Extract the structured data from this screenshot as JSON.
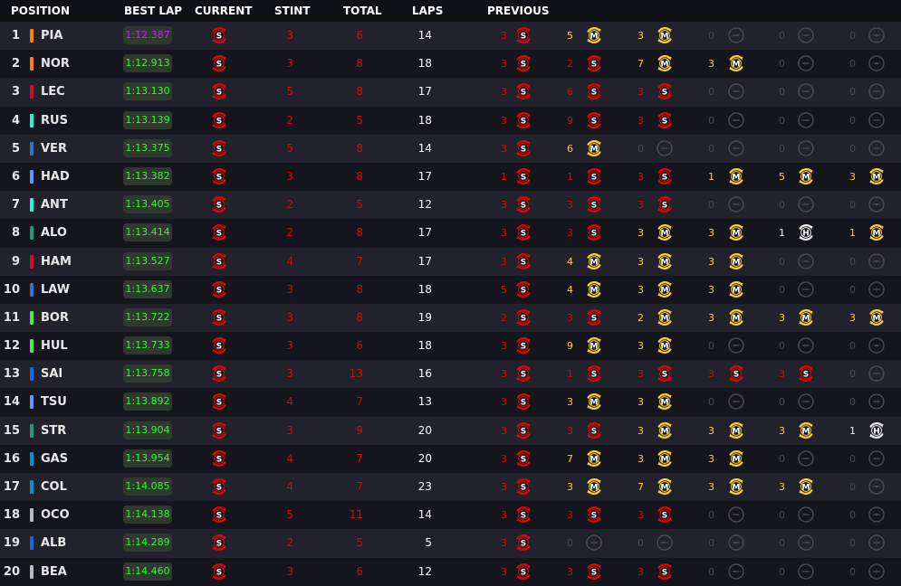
{
  "header": {
    "position": "POSITION",
    "best_lap": "BEST LAP",
    "current": "CURRENT",
    "stint": "STINT",
    "total": "TOTAL",
    "laps": "LAPS",
    "previous": "PREVIOUS"
  },
  "colors": {
    "soft": "#e10600",
    "medium": "#ffd12e",
    "hard": "#f0f0f0",
    "empty": "#4a4a55",
    "purple_lap": "#cc22ff",
    "green_lap": "#3ef03e"
  },
  "rows": [
    {
      "pos": "1",
      "driver": "PIA",
      "team_color": "#ff8000",
      "best_lap": "1:12.387",
      "best_lap_kind": "purple",
      "current": "S",
      "stint": "3",
      "total": "6",
      "laps": "14",
      "previous": [
        {
          "n": "3",
          "c": "S"
        },
        {
          "n": "5",
          "c": "M"
        },
        {
          "n": "3",
          "c": "M"
        },
        {
          "n": "0",
          "c": "E"
        },
        {
          "n": "0",
          "c": "E"
        },
        {
          "n": "0",
          "c": "E"
        }
      ]
    },
    {
      "pos": "2",
      "driver": "NOR",
      "team_color": "#ff8000",
      "best_lap": "1:12.913",
      "best_lap_kind": "green",
      "current": "S",
      "stint": "3",
      "total": "8",
      "laps": "18",
      "previous": [
        {
          "n": "3",
          "c": "S"
        },
        {
          "n": "2",
          "c": "S"
        },
        {
          "n": "7",
          "c": "M"
        },
        {
          "n": "3",
          "c": "M"
        },
        {
          "n": "0",
          "c": "E"
        },
        {
          "n": "0",
          "c": "E"
        }
      ]
    },
    {
      "pos": "3",
      "driver": "LEC",
      "team_color": "#c8102e",
      "best_lap": "1:13.130",
      "best_lap_kind": "green",
      "current": "S",
      "stint": "5",
      "total": "8",
      "laps": "17",
      "previous": [
        {
          "n": "3",
          "c": "S"
        },
        {
          "n": "6",
          "c": "S"
        },
        {
          "n": "3",
          "c": "S"
        },
        {
          "n": "0",
          "c": "E"
        },
        {
          "n": "0",
          "c": "E"
        },
        {
          "n": "0",
          "c": "E"
        }
      ]
    },
    {
      "pos": "4",
      "driver": "RUS",
      "team_color": "#27f4d2",
      "best_lap": "1:13.139",
      "best_lap_kind": "green",
      "current": "S",
      "stint": "2",
      "total": "5",
      "laps": "18",
      "previous": [
        {
          "n": "3",
          "c": "S"
        },
        {
          "n": "9",
          "c": "S"
        },
        {
          "n": "3",
          "c": "S"
        },
        {
          "n": "0",
          "c": "E"
        },
        {
          "n": "0",
          "c": "E"
        },
        {
          "n": "0",
          "c": "E"
        }
      ]
    },
    {
      "pos": "5",
      "driver": "VER",
      "team_color": "#3671c6",
      "best_lap": "1:13.375",
      "best_lap_kind": "green",
      "current": "S",
      "stint": "5",
      "total": "8",
      "laps": "14",
      "previous": [
        {
          "n": "3",
          "c": "S"
        },
        {
          "n": "6",
          "c": "M"
        },
        {
          "n": "0",
          "c": "E"
        },
        {
          "n": "0",
          "c": "E"
        },
        {
          "n": "0",
          "c": "E"
        },
        {
          "n": "0",
          "c": "E"
        }
      ]
    },
    {
      "pos": "6",
      "driver": "HAD",
      "team_color": "#6692ff",
      "best_lap": "1:13.382",
      "best_lap_kind": "green",
      "current": "S",
      "stint": "3",
      "total": "8",
      "laps": "17",
      "previous": [
        {
          "n": "1",
          "c": "S"
        },
        {
          "n": "1",
          "c": "S"
        },
        {
          "n": "3",
          "c": "S"
        },
        {
          "n": "1",
          "c": "M"
        },
        {
          "n": "5",
          "c": "M"
        },
        {
          "n": "3",
          "c": "M"
        }
      ]
    },
    {
      "pos": "7",
      "driver": "ANT",
      "team_color": "#27f4d2",
      "best_lap": "1:13.405",
      "best_lap_kind": "green",
      "current": "S",
      "stint": "2",
      "total": "5",
      "laps": "12",
      "previous": [
        {
          "n": "3",
          "c": "S"
        },
        {
          "n": "3",
          "c": "S"
        },
        {
          "n": "3",
          "c": "S"
        },
        {
          "n": "0",
          "c": "E"
        },
        {
          "n": "0",
          "c": "E"
        },
        {
          "n": "0",
          "c": "E"
        }
      ]
    },
    {
      "pos": "8",
      "driver": "ALO",
      "team_color": "#229971",
      "best_lap": "1:13.414",
      "best_lap_kind": "green",
      "current": "S",
      "stint": "2",
      "total": "8",
      "laps": "17",
      "previous": [
        {
          "n": "3",
          "c": "S"
        },
        {
          "n": "3",
          "c": "S"
        },
        {
          "n": "3",
          "c": "M"
        },
        {
          "n": "3",
          "c": "M"
        },
        {
          "n": "1",
          "c": "H"
        },
        {
          "n": "1",
          "c": "M"
        }
      ]
    },
    {
      "pos": "9",
      "driver": "HAM",
      "team_color": "#c8102e",
      "best_lap": "1:13.527",
      "best_lap_kind": "green",
      "current": "S",
      "stint": "4",
      "total": "7",
      "laps": "17",
      "previous": [
        {
          "n": "3",
          "c": "S"
        },
        {
          "n": "4",
          "c": "M"
        },
        {
          "n": "3",
          "c": "M"
        },
        {
          "n": "3",
          "c": "M"
        },
        {
          "n": "0",
          "c": "E"
        },
        {
          "n": "0",
          "c": "E"
        }
      ]
    },
    {
      "pos": "10",
      "driver": "LAW",
      "team_color": "#3671c6",
      "best_lap": "1:13.637",
      "best_lap_kind": "green",
      "current": "S",
      "stint": "3",
      "total": "8",
      "laps": "18",
      "previous": [
        {
          "n": "5",
          "c": "S"
        },
        {
          "n": "4",
          "c": "M"
        },
        {
          "n": "3",
          "c": "M"
        },
        {
          "n": "3",
          "c": "M"
        },
        {
          "n": "0",
          "c": "E"
        },
        {
          "n": "0",
          "c": "E"
        }
      ]
    },
    {
      "pos": "11",
      "driver": "BOR",
      "team_color": "#52e252",
      "best_lap": "1:13.722",
      "best_lap_kind": "green",
      "current": "S",
      "stint": "3",
      "total": "8",
      "laps": "19",
      "previous": [
        {
          "n": "2",
          "c": "S"
        },
        {
          "n": "3",
          "c": "S"
        },
        {
          "n": "2",
          "c": "M"
        },
        {
          "n": "3",
          "c": "M"
        },
        {
          "n": "3",
          "c": "M"
        },
        {
          "n": "3",
          "c": "M"
        }
      ]
    },
    {
      "pos": "12",
      "driver": "HUL",
      "team_color": "#52e252",
      "best_lap": "1:13.733",
      "best_lap_kind": "green",
      "current": "S",
      "stint": "3",
      "total": "6",
      "laps": "18",
      "previous": [
        {
          "n": "3",
          "c": "S"
        },
        {
          "n": "9",
          "c": "M"
        },
        {
          "n": "3",
          "c": "M"
        },
        {
          "n": "0",
          "c": "E"
        },
        {
          "n": "0",
          "c": "E"
        },
        {
          "n": "0",
          "c": "E"
        }
      ]
    },
    {
      "pos": "13",
      "driver": "SAI",
      "team_color": "#1868db",
      "best_lap": "1:13.758",
      "best_lap_kind": "green",
      "current": "S",
      "stint": "3",
      "total": "13",
      "laps": "16",
      "previous": [
        {
          "n": "3",
          "c": "S"
        },
        {
          "n": "1",
          "c": "S"
        },
        {
          "n": "3",
          "c": "S"
        },
        {
          "n": "3",
          "c": "S"
        },
        {
          "n": "3",
          "c": "S"
        },
        {
          "n": "0",
          "c": "E"
        }
      ]
    },
    {
      "pos": "14",
      "driver": "TSU",
      "team_color": "#6692ff",
      "best_lap": "1:13.892",
      "best_lap_kind": "green",
      "current": "S",
      "stint": "4",
      "total": "7",
      "laps": "13",
      "previous": [
        {
          "n": "3",
          "c": "S"
        },
        {
          "n": "3",
          "c": "M"
        },
        {
          "n": "3",
          "c": "M"
        },
        {
          "n": "0",
          "c": "E"
        },
        {
          "n": "0",
          "c": "E"
        },
        {
          "n": "0",
          "c": "E"
        }
      ]
    },
    {
      "pos": "15",
      "driver": "STR",
      "team_color": "#229971",
      "best_lap": "1:13.904",
      "best_lap_kind": "green",
      "current": "S",
      "stint": "3",
      "total": "9",
      "laps": "20",
      "previous": [
        {
          "n": "3",
          "c": "S"
        },
        {
          "n": "3",
          "c": "S"
        },
        {
          "n": "3",
          "c": "M"
        },
        {
          "n": "3",
          "c": "M"
        },
        {
          "n": "3",
          "c": "M"
        },
        {
          "n": "1",
          "c": "H"
        }
      ]
    },
    {
      "pos": "16",
      "driver": "GAS",
      "team_color": "#0093cc",
      "best_lap": "1:13.954",
      "best_lap_kind": "green",
      "current": "S",
      "stint": "4",
      "total": "7",
      "laps": "20",
      "previous": [
        {
          "n": "3",
          "c": "S"
        },
        {
          "n": "7",
          "c": "M"
        },
        {
          "n": "3",
          "c": "M"
        },
        {
          "n": "3",
          "c": "M"
        },
        {
          "n": "0",
          "c": "E"
        },
        {
          "n": "0",
          "c": "E"
        }
      ]
    },
    {
      "pos": "17",
      "driver": "COL",
      "team_color": "#0093cc",
      "best_lap": "1:14.085",
      "best_lap_kind": "green",
      "current": "S",
      "stint": "4",
      "total": "7",
      "laps": "23",
      "previous": [
        {
          "n": "3",
          "c": "S"
        },
        {
          "n": "3",
          "c": "M"
        },
        {
          "n": "7",
          "c": "M"
        },
        {
          "n": "3",
          "c": "M"
        },
        {
          "n": "3",
          "c": "M"
        },
        {
          "n": "0",
          "c": "E"
        }
      ]
    },
    {
      "pos": "18",
      "driver": "OCO",
      "team_color": "#b6babd",
      "best_lap": "1:14.138",
      "best_lap_kind": "green",
      "current": "S",
      "stint": "5",
      "total": "11",
      "laps": "14",
      "previous": [
        {
          "n": "3",
          "c": "S"
        },
        {
          "n": "3",
          "c": "S"
        },
        {
          "n": "3",
          "c": "S"
        },
        {
          "n": "0",
          "c": "E"
        },
        {
          "n": "0",
          "c": "E"
        },
        {
          "n": "0",
          "c": "E"
        }
      ]
    },
    {
      "pos": "19",
      "driver": "ALB",
      "team_color": "#1868db",
      "best_lap": "1:14.289",
      "best_lap_kind": "green",
      "current": "S",
      "stint": "2",
      "total": "5",
      "laps": "5",
      "previous": [
        {
          "n": "3",
          "c": "S"
        },
        {
          "n": "0",
          "c": "E"
        },
        {
          "n": "0",
          "c": "E"
        },
        {
          "n": "0",
          "c": "E"
        },
        {
          "n": "0",
          "c": "E"
        },
        {
          "n": "0",
          "c": "E"
        }
      ]
    },
    {
      "pos": "20",
      "driver": "BEA",
      "team_color": "#b6babd",
      "best_lap": "1:14.460",
      "best_lap_kind": "green",
      "current": "S",
      "stint": "3",
      "total": "6",
      "laps": "12",
      "previous": [
        {
          "n": "3",
          "c": "S"
        },
        {
          "n": "3",
          "c": "S"
        },
        {
          "n": "3",
          "c": "S"
        },
        {
          "n": "0",
          "c": "E"
        },
        {
          "n": "0",
          "c": "E"
        },
        {
          "n": "0",
          "c": "E"
        }
      ]
    }
  ]
}
